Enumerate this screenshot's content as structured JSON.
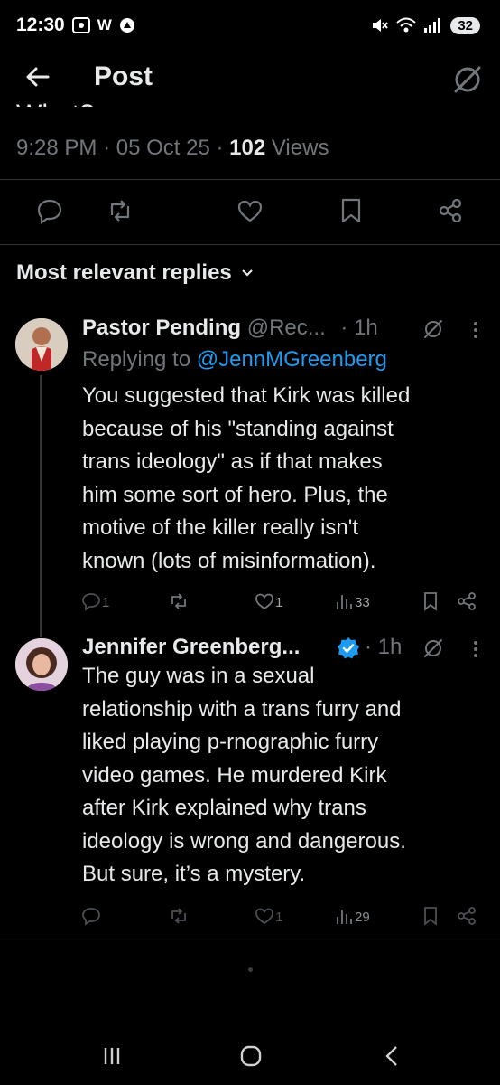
{
  "status_bar": {
    "time": "12:30",
    "notif_icons": "W",
    "battery": "32"
  },
  "header": {
    "title": "Post"
  },
  "post": {
    "clipped_text": "What?",
    "time": "9:28 PM",
    "sep": "·",
    "date": "05 Oct 25",
    "views_count": "102",
    "views_label": "Views"
  },
  "replies_header": {
    "label": "Most relevant replies"
  },
  "replies": [
    {
      "name": "Pastor Pending",
      "handle": "@Rec...",
      "time": "· 1h",
      "replying_prefix": "Replying to ",
      "replying_to": "@JennMGreenberg",
      "lines": [
        "You suggested that Kirk was killed",
        "because of his \"standing against",
        "trans ideology\" as if that makes",
        "him some sort of hero. Plus, the",
        "motive of the killer really isn't",
        "known (lots of misinformation)."
      ],
      "reply_count": "1",
      "like_count": "1",
      "views": "33"
    },
    {
      "name": "Jennifer Greenberg...",
      "time": "· 1h",
      "lines": [
        "The guy was in a sexual",
        "relationship with a trans furry and",
        "liked playing p-rnographic furry",
        "video games. He murdered Kirk",
        "after Kirk explained why trans",
        "ideology is wrong and dangerous.",
        "But sure, it’s a mystery."
      ],
      "like_count": "1",
      "views": "29"
    }
  ],
  "colors": {
    "accent": "#1d9bf0",
    "muted": "#71767b",
    "text": "#e7e9ea",
    "bg": "#000000"
  }
}
